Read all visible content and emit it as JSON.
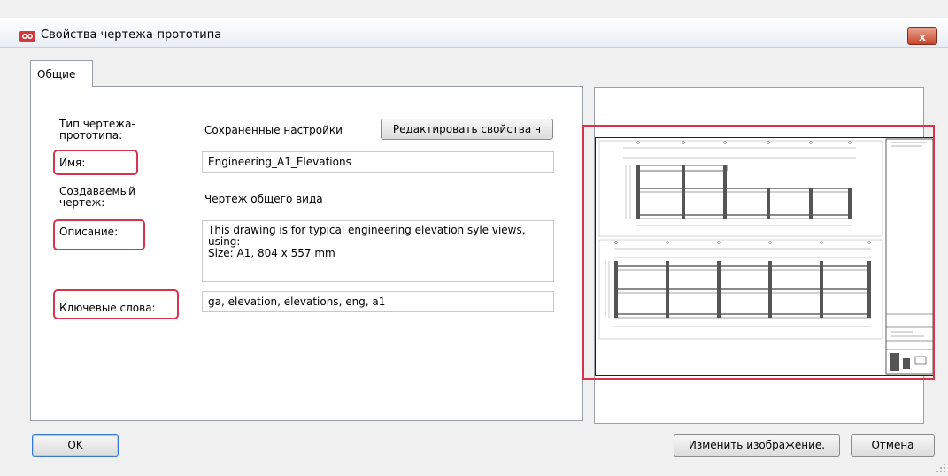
{
  "window": {
    "title": "Свойства чертежа-прототипа",
    "close_label": "x"
  },
  "tabs": [
    {
      "label": "Общие"
    }
  ],
  "form": {
    "template_type_label": "Тип чертежа-прототипа:",
    "template_type_value": "Сохраненные настройки",
    "edit_button_label": "Редактировать свойства ч",
    "name_label": "Имя:",
    "name_value": "Engineering_A1_Elevations",
    "created_drawing_label": "Создаваемый чертеж:",
    "created_drawing_value": "Чертеж общего вида",
    "description_label": "Описание:",
    "description_value": "This drawing is for typical engineering elevation syle views, using:\nSize: A1, 804 x 557 mm",
    "keywords_label": "Ключевые слова:",
    "keywords_value": "ga, elevation, elevations, eng, a1"
  },
  "buttons": {
    "ok": "OK",
    "change_image": "Изменить изображение.",
    "cancel": "Отмена"
  },
  "colors": {
    "highlight": "#d6334d",
    "dialog_bg": "#f0f0f0"
  },
  "icons": {
    "app": "app-logo-icon",
    "close": "close-icon"
  }
}
